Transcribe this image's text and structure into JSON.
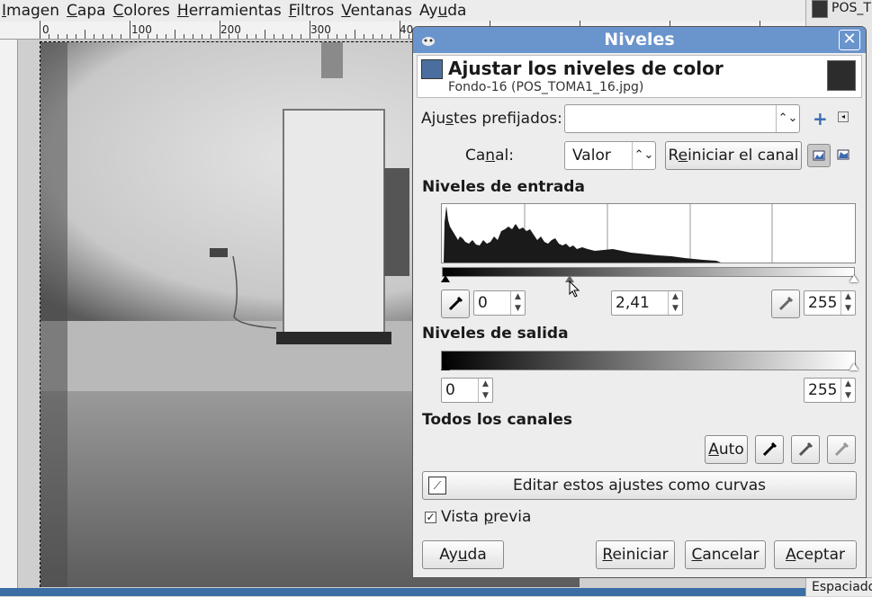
{
  "menubar": {
    "items": [
      {
        "label": "Imagen",
        "u": "I"
      },
      {
        "label": "Capa",
        "u": "C"
      },
      {
        "label": "Colores",
        "u": "C"
      },
      {
        "label": "Herramientas",
        "u": "H"
      },
      {
        "label": "Filtros",
        "u": "F"
      },
      {
        "label": "Ventanas",
        "u": "V"
      },
      {
        "label": "Ayuda",
        "u": "u"
      }
    ]
  },
  "ruler": {
    "labels": [
      "0",
      "100",
      "200",
      "300",
      "40"
    ]
  },
  "dock": {
    "title": "POS_T",
    "footer": "Espaciado"
  },
  "dialog": {
    "title": "Niveles",
    "header_title": "Ajustar los niveles de color",
    "header_subtitle": "Fondo-16 (POS_TOMA1_16.jpg)",
    "presets_label_pre": "Aju",
    "presets_label_ul": "s",
    "presets_label_post": "tes prefijados:",
    "presets_value": "",
    "channel_label_pre": "Ca",
    "channel_label_ul": "n",
    "channel_label_post": "al:",
    "channel_value": "Valor",
    "reset_channel_pre": "R",
    "reset_channel_ul": "e",
    "reset_channel_post": "iniciar el canal",
    "input_levels_title": "Niveles de entrada",
    "input_low": "0",
    "input_gamma": "2,41",
    "input_high": "255",
    "output_levels_title": "Niveles de salida",
    "output_low": "0",
    "output_high": "255",
    "all_channels_title": "Todos los canales",
    "auto_pre": "",
    "auto_ul": "A",
    "auto_post": "uto",
    "edit_curves_label": "Editar estos ajustes como curvas",
    "preview_pre": "Vista ",
    "preview_ul": "p",
    "preview_post": "revia",
    "preview_checked": true,
    "help_pre": "Ay",
    "help_ul": "u",
    "help_post": "da",
    "reset_pre": "",
    "reset_ul": "R",
    "reset_post": "einiciar",
    "cancel_pre": "",
    "cancel_ul": "C",
    "cancel_post": "ancelar",
    "ok_pre": "",
    "ok_ul": "A",
    "ok_post": "ceptar"
  },
  "colors": {
    "titlebar": "#6a94cc",
    "statusbar": "#3a6ea5"
  }
}
